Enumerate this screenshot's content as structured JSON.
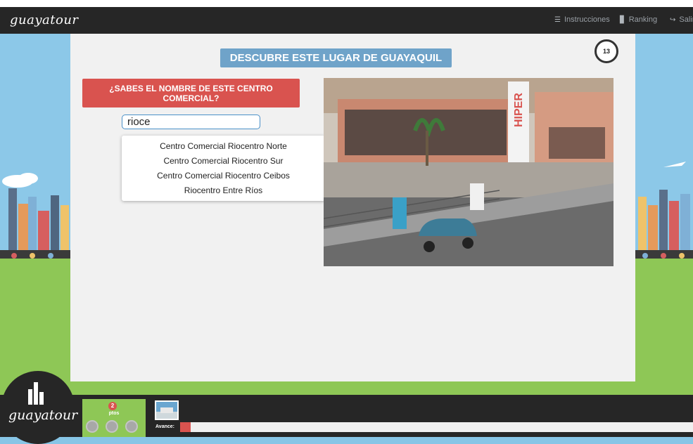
{
  "header": {
    "logo_text": "guayatour",
    "nav": [
      {
        "label": "Instrucciones",
        "icon": "list-icon"
      },
      {
        "label": "Ranking",
        "icon": "bar-chart-icon"
      },
      {
        "label": "Salir",
        "icon": "logout-icon"
      }
    ]
  },
  "game": {
    "title": "DESCUBRE ESTE LUGAR DE GUAYAQUIL",
    "timer": "13",
    "question": "¿SABES EL NOMBRE DE ESTE CENTRO COMERCIAL?",
    "answer_value": "rioce",
    "suggestions": [
      "Centro Comercial Riocentro Norte",
      "Centro Comercial Riocentro Sur",
      "Centro Comercial Riocentro Ceibos",
      "Riocentro Entre Ríos"
    ],
    "photo_sign": "HIPER"
  },
  "footer": {
    "logo_text": "guayatour",
    "score_count": "2",
    "score_unit": "ptos",
    "avance_label": "Avance:",
    "progress_fraction": 0.02
  },
  "colors": {
    "accent_red": "#d9534f",
    "title_blue": "#6fa3c9",
    "grass": "#8ec756",
    "dark": "#262626"
  }
}
